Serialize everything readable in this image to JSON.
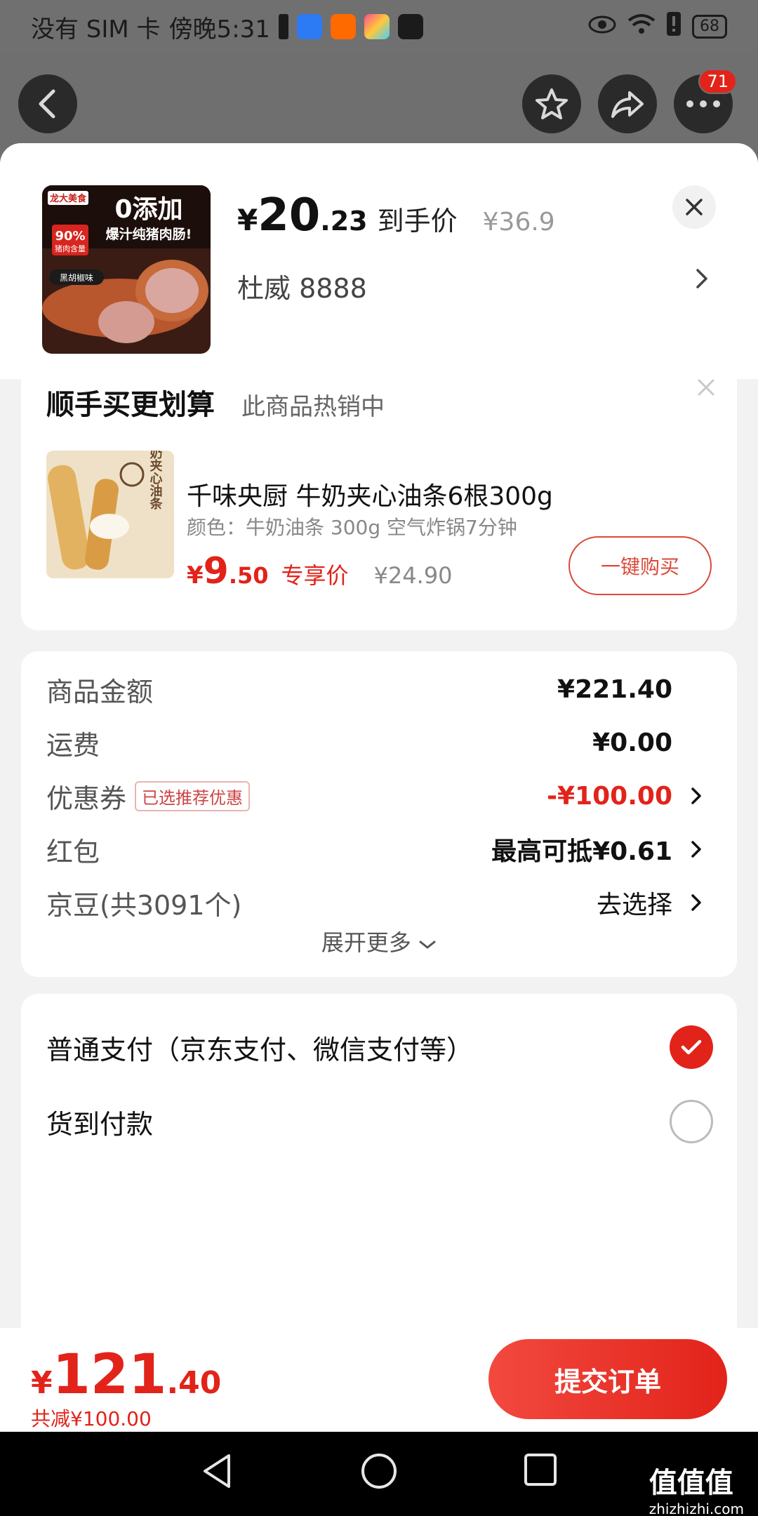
{
  "status_bar": {
    "carrier": "没有 SIM 卡",
    "time": "傍晚5:31",
    "battery": "68"
  },
  "nav": {
    "more_badge": "71"
  },
  "product": {
    "price_symbol": "¥",
    "price_int": "20",
    "price_dec": ".23",
    "price_tag": "到手价",
    "original_price": "¥36.9",
    "spec": "杜威  8888",
    "image_text": {
      "brand": "龙大美食",
      "headline": "0添加",
      "subline": "爆汁纯猪肉肠!",
      "badge": "90%",
      "badge_sub": "猪肉含量",
      "flavor": "黑胡椒味"
    }
  },
  "upsell": {
    "title": "顺手买更划算",
    "subtitle": "此商品热销中",
    "product_name": "千味央厨 牛奶夹心油条6根300g",
    "product_spec": "颜色：牛奶油条 300g 空气炸锅7分钟",
    "price_symbol": "¥",
    "price_int": "9",
    "price_dec": ".50",
    "exclusive_label": "专享价",
    "original_price": "¥24.90",
    "buy_button": "一键购买",
    "thumb_text": "牛奶夹心油条"
  },
  "summary": {
    "rows": [
      {
        "label": "商品金额",
        "value": "¥221.40"
      },
      {
        "label": "运费",
        "value": "¥0.00"
      },
      {
        "label": "优惠券",
        "pill": "已选推荐优惠",
        "value": "-¥100.00"
      },
      {
        "label": "红包",
        "value": "最高可抵¥0.61"
      },
      {
        "label": "京豆(共3091个)",
        "value": "去选择"
      }
    ],
    "expand": "展开更多"
  },
  "payment": {
    "options": [
      {
        "label": "普通支付（京东支付、微信支付等）",
        "selected": true
      },
      {
        "label": "货到付款",
        "selected": false
      }
    ]
  },
  "bottom": {
    "price_symbol": "¥",
    "price_int": "121",
    "price_dec": ".40",
    "saved": "共减¥100.00",
    "submit": "提交订单"
  },
  "watermark": {
    "title": "值值值",
    "url": "zhizhizhi.com"
  },
  "colors": {
    "accent": "#e2231a",
    "overlay": "#6f6f6f"
  }
}
